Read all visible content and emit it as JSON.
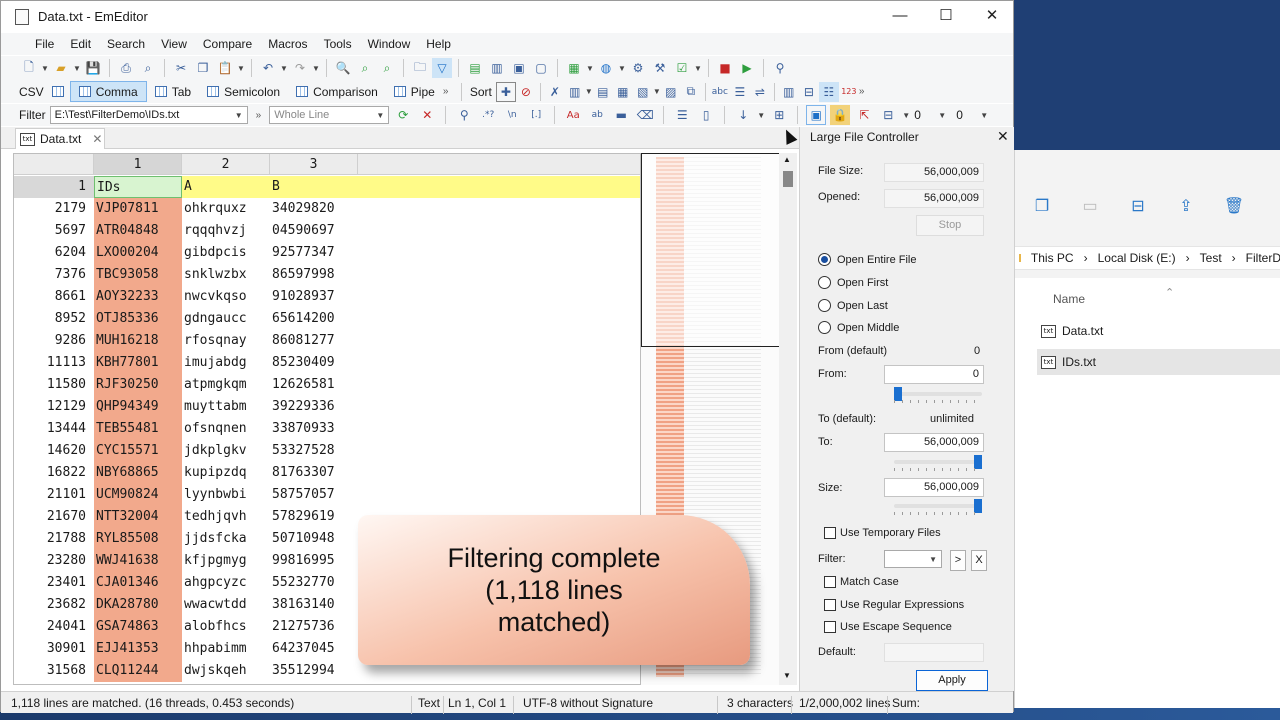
{
  "window": {
    "title": "Data.txt - EmEditor"
  },
  "menu": [
    "File",
    "Edit",
    "Search",
    "View",
    "Compare",
    "Macros",
    "Tools",
    "Window",
    "Help"
  ],
  "csv_toolbar": {
    "csv_label": "CSV",
    "buttons": [
      "Comma",
      "Tab",
      "Semicolon",
      "Comparison",
      "Pipe"
    ],
    "active": "Comma",
    "sort_label": "Sort"
  },
  "filter_toolbar": {
    "label": "Filter",
    "path": "E:\\Test\\FilterDemo\\IDs.txt",
    "mode": "Whole Line",
    "count_a": "0",
    "count_b": "0"
  },
  "tab": {
    "label": "Data.txt"
  },
  "grid": {
    "columns": [
      "1",
      "2",
      "3"
    ],
    "header_row": {
      "line": "1",
      "c1": "IDs",
      "c2": "A",
      "c3": "B"
    },
    "rows": [
      {
        "line": "2179",
        "c1": "VJP07811",
        "c2": "ohkrquxz",
        "c3": "34029820"
      },
      {
        "line": "5697",
        "c1": "ATR04848",
        "c2": "rqqqhvzj",
        "c3": "04590697"
      },
      {
        "line": "6204",
        "c1": "LXO00204",
        "c2": "gibdpcis",
        "c3": "92577347"
      },
      {
        "line": "7376",
        "c1": "TBC93058",
        "c2": "snklwzbx",
        "c3": "86597998"
      },
      {
        "line": "8661",
        "c1": "AOY32233",
        "c2": "nwcvkqso",
        "c3": "91028937"
      },
      {
        "line": "8952",
        "c1": "OTJ85336",
        "c2": "gdngaucc",
        "c3": "65614200"
      },
      {
        "line": "9286",
        "c1": "MUH16218",
        "c2": "rfosqnay",
        "c3": "86081277"
      },
      {
        "line": "11113",
        "c1": "KBH77801",
        "c2": "imujabdg",
        "c3": "85230409"
      },
      {
        "line": "11580",
        "c1": "RJF30250",
        "c2": "atpmgkqm",
        "c3": "12626581"
      },
      {
        "line": "12129",
        "c1": "QHP94349",
        "c2": "muyttabm",
        "c3": "39229336"
      },
      {
        "line": "13444",
        "c1": "TEB55481",
        "c2": "ofsnqnen",
        "c3": "33870933"
      },
      {
        "line": "14620",
        "c1": "CYC15571",
        "c2": "jdkplgkv",
        "c3": "53327528"
      },
      {
        "line": "16822",
        "c1": "NBY68865",
        "c2": "kupipzdq",
        "c3": "81763307"
      },
      {
        "line": "21101",
        "c1": "UCM90824",
        "c2": "lyynbwbi",
        "c3": "58757057"
      },
      {
        "line": "21670",
        "c1": "NTT32004",
        "c2": "tedhjqvh",
        "c3": "57829619"
      },
      {
        "line": "21788",
        "c1": "RYL85508",
        "c2": "jjdsfcka",
        "c3": "50710948"
      },
      {
        "line": "23280",
        "c1": "WWJ41638",
        "c2": "kfjpgmyg",
        "c3": "99816995"
      },
      {
        "line": "23401",
        "c1": "CJA01346",
        "c2": "ahgpcyzc",
        "c3": "55232770"
      },
      {
        "line": "23682",
        "c1": "DKA28780",
        "c2": "wwacwtdd",
        "c3": "38163140"
      },
      {
        "line": "24041",
        "c1": "GSA74863",
        "c2": "alobfhcs",
        "c3": "21275736"
      },
      {
        "line": "30901",
        "c1": "EJJ41353",
        "c2": "hhpabimm",
        "c3": "64237045"
      },
      {
        "line": "31568",
        "c1": "CLQ11244",
        "c2": "dwjskqeh",
        "c3": "35512994"
      }
    ]
  },
  "status": {
    "message": "1,118 lines are matched. (16 threads, 0.453 seconds)",
    "mode": "Text",
    "position": "Ln 1, Col 1",
    "encoding": "UTF-8 without Signature",
    "selection": "3 characters",
    "lines": "1/2,000,002 lines",
    "sum": "Sum:"
  },
  "lfc": {
    "title": "Large File Controller",
    "file_size_label": "File Size:",
    "file_size": "56,000,009",
    "opened_label": "Opened:",
    "opened": "56,000,009",
    "stop": "Stop",
    "radios": [
      "Open Entire File",
      "Open First",
      "Open Last",
      "Open Middle"
    ],
    "from_default_label": "From (default)",
    "from_default": "0",
    "from_label": "From:",
    "from": "0",
    "to_default_label": "To (default):",
    "to_default": "unlimited",
    "to_label": "To:",
    "to": "56,000,009",
    "size_label": "Size:",
    "size": "56,000,009",
    "use_temp": "Use Temporary Files",
    "filter_label": "Filter:",
    "next_btn": ">",
    "clear_btn": "X",
    "match_case": "Match Case",
    "regex": "Use Regular Expressions",
    "escape": "Use Escape Sequence",
    "default_label": "Default:",
    "apply": "Apply"
  },
  "banner": {
    "line1": "Filtering complete",
    "line2": "(1,118 lines",
    "line3": "matched)"
  },
  "explorer": {
    "breadcrumb": [
      "This PC",
      "Local Disk (E:)",
      "Test",
      "FilterD"
    ],
    "column_name": "Name",
    "files": [
      "Data.txt",
      "IDs.txt"
    ]
  },
  "colors": {
    "accent": "#1a6fd0",
    "id_column": "#f2a98c",
    "header_row": "#fffb88"
  }
}
